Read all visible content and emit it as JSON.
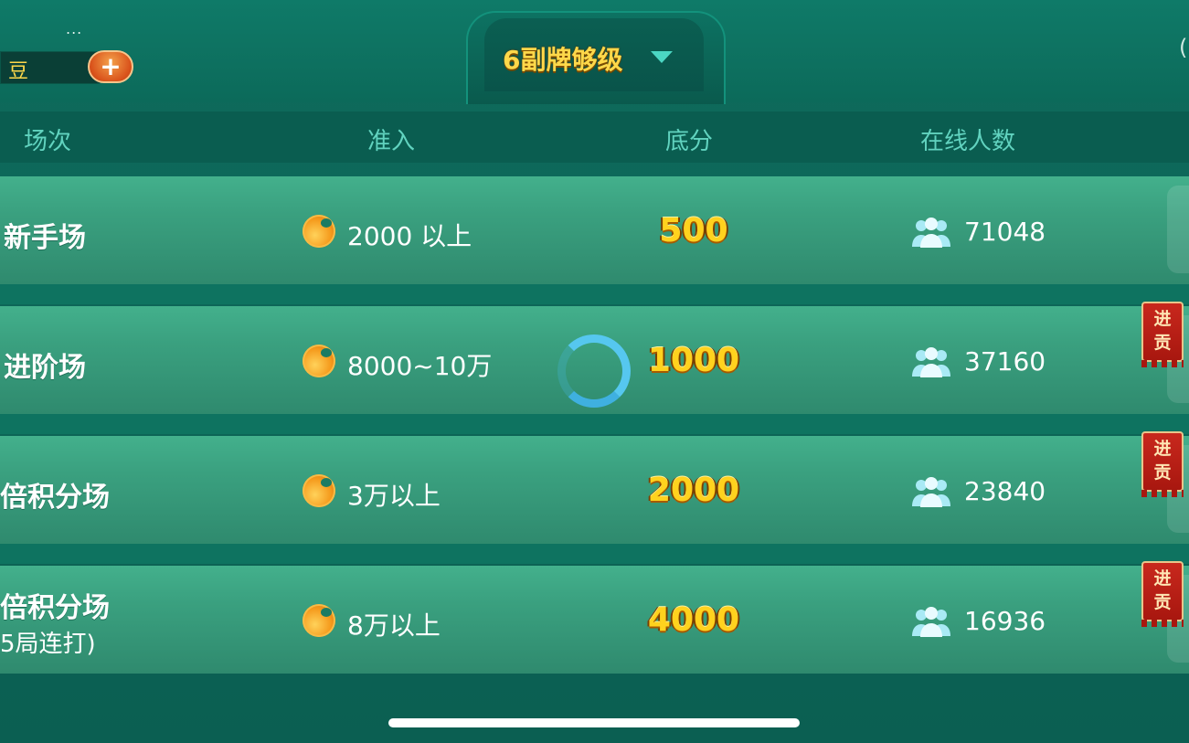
{
  "top": {
    "dots": "...",
    "currency_label": "豆",
    "add_label": "+",
    "dropdown": "6副牌够级",
    "right_partial": "("
  },
  "header": {
    "col1": "场次",
    "col2": "准入",
    "col3": "底分",
    "col4": "在线人数"
  },
  "rows": [
    {
      "name": "新手场",
      "sub": "",
      "entry": "2000 以上",
      "score": "500",
      "online": "71048",
      "tribute": ""
    },
    {
      "name": "进阶场",
      "sub": "",
      "entry": "8000~10万",
      "score": "1000",
      "online": "37160",
      "tribute": "进贡"
    },
    {
      "name": "倍积分场",
      "sub": "",
      "entry": "3万以上",
      "score": "2000",
      "online": "23840",
      "tribute": "进贡"
    },
    {
      "name": "倍积分场",
      "sub": "5局连打)",
      "entry": "8万以上",
      "score": "4000",
      "online": "16936",
      "tribute": "进贡"
    }
  ],
  "tribute_chars": [
    "进",
    "贡"
  ],
  "colors": {
    "accent_yellow": "#ffd21e",
    "header_text": "#61d3bf",
    "row_green": "#3aa07f",
    "tribute_red": "#b91d14"
  },
  "icons": {
    "coin": "coin-icon",
    "users": "users-icon",
    "dropdown": "triangle-down-icon",
    "spinner": "loading-spinner"
  }
}
